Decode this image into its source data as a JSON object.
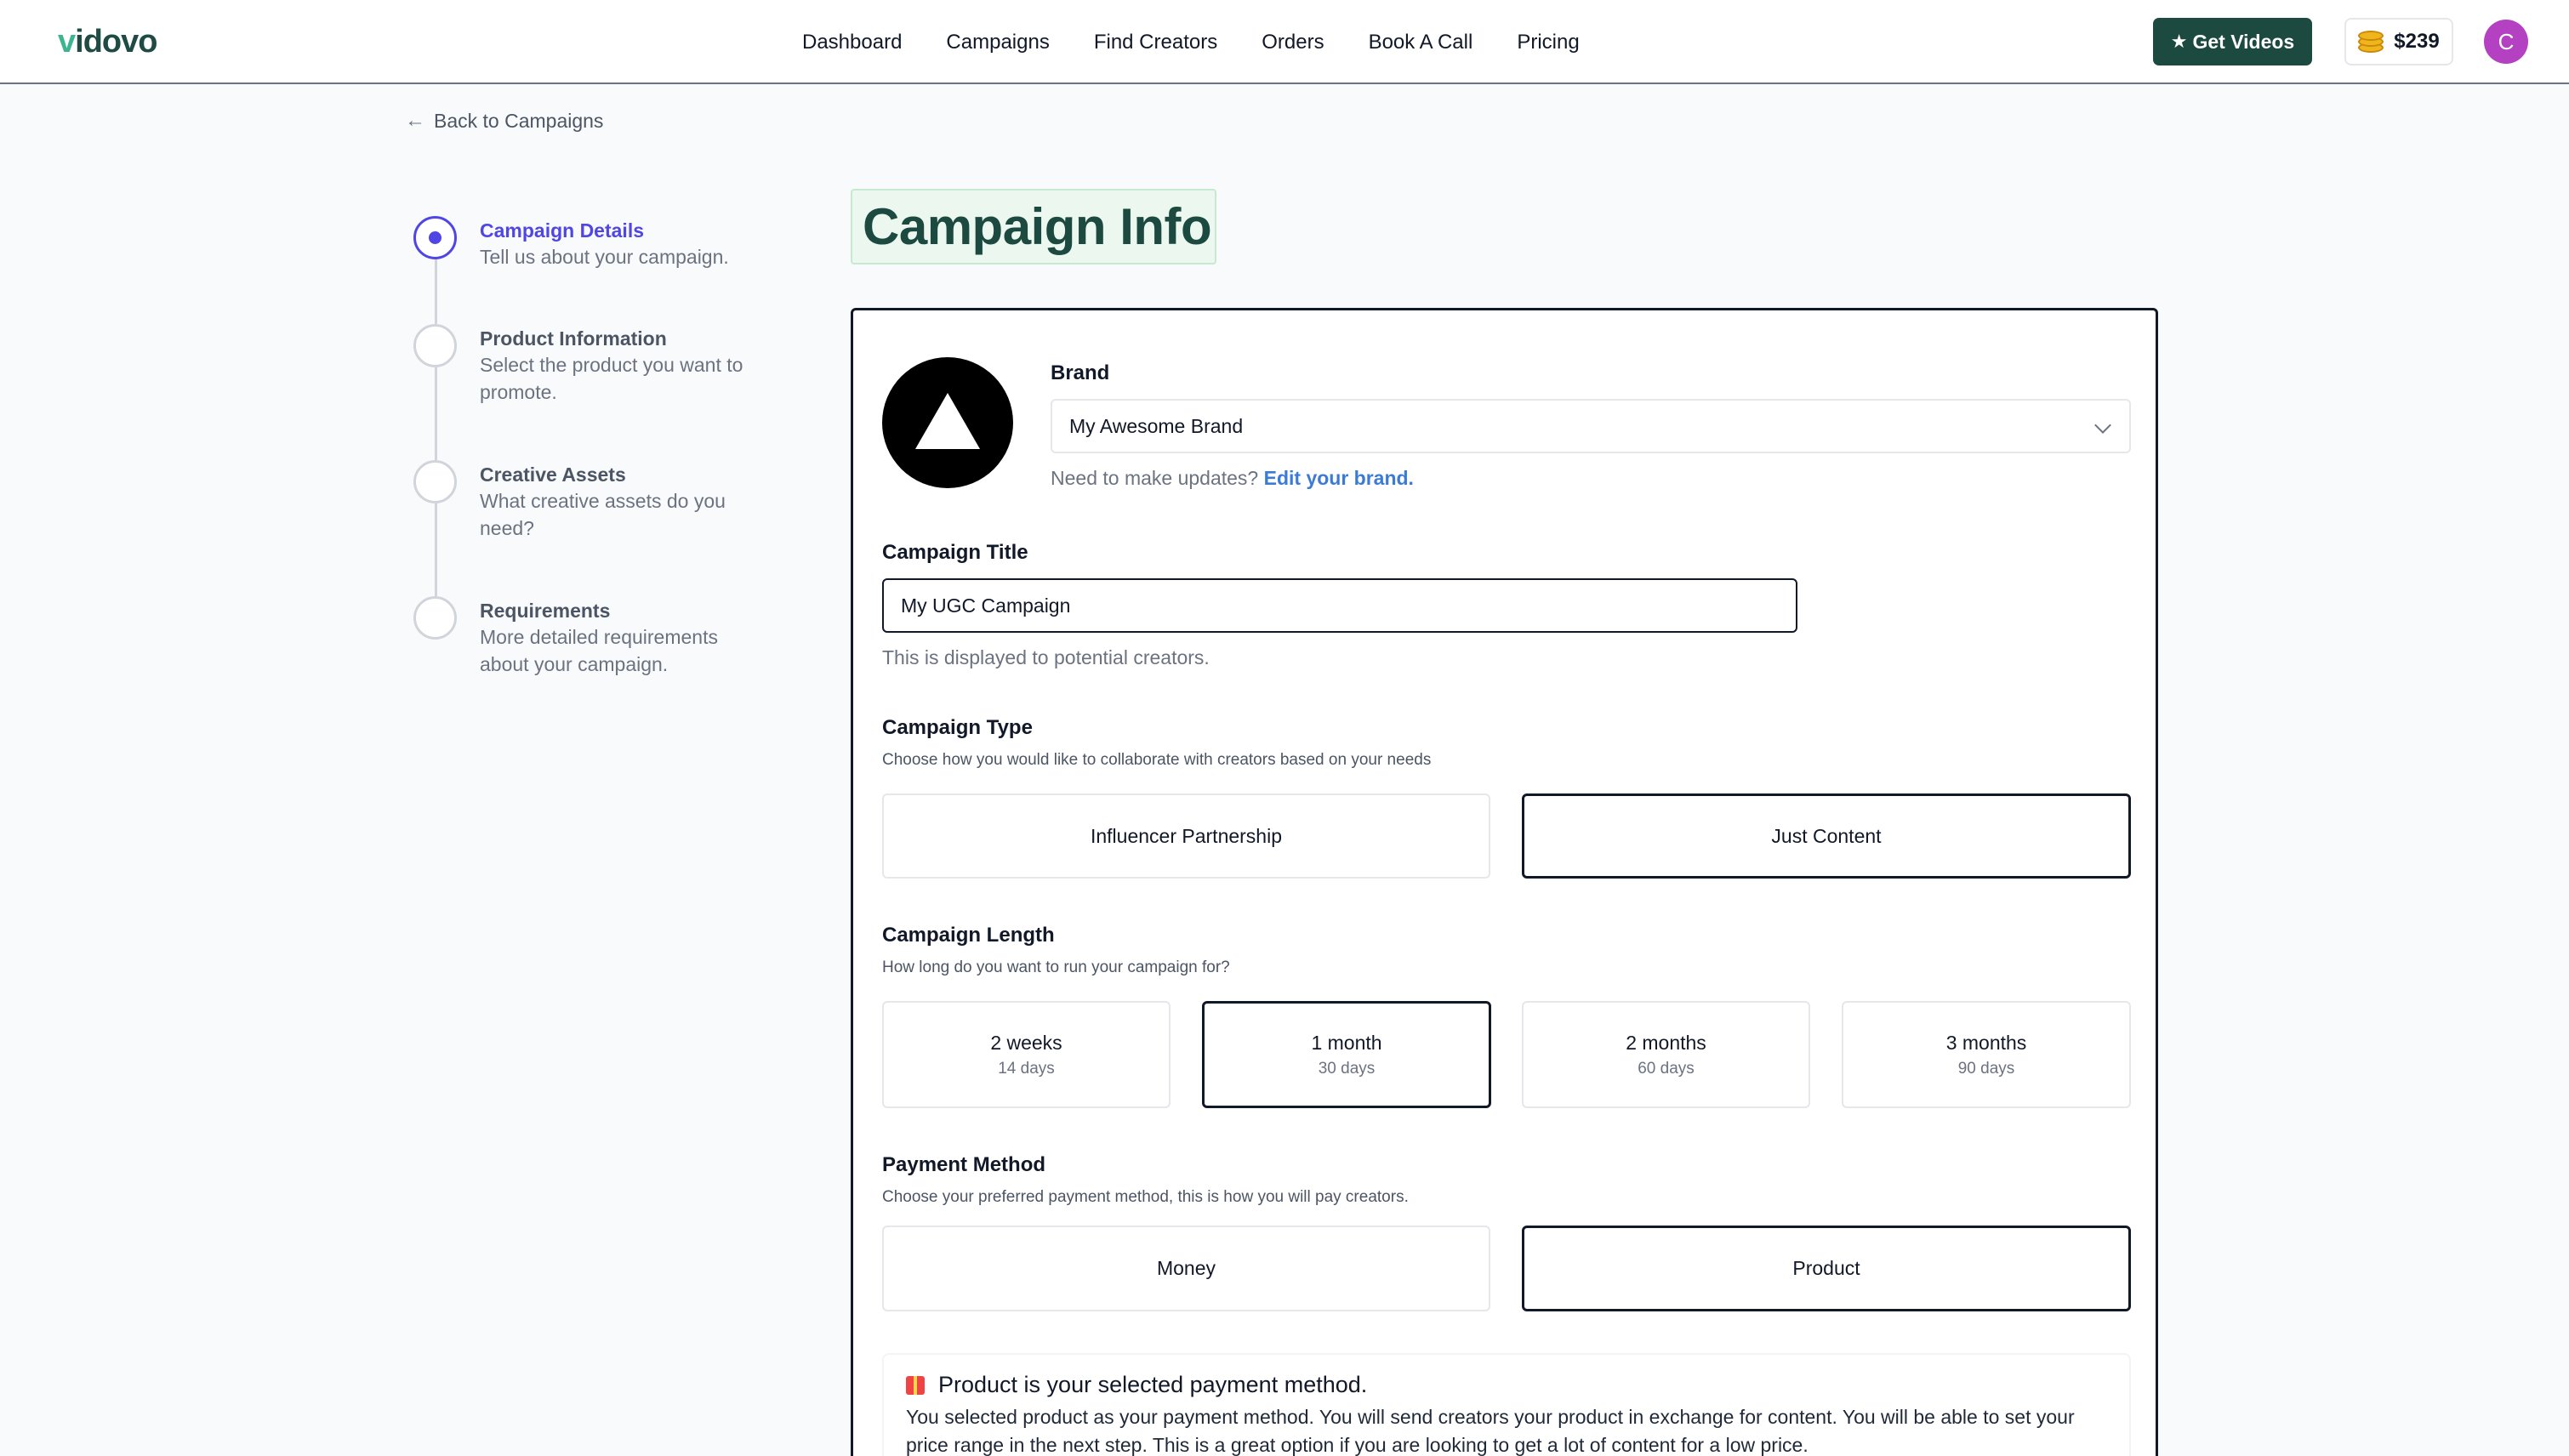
{
  "nav": {
    "logo_prefix": "v",
    "logo_rest": "idovo",
    "links": [
      "Dashboard",
      "Campaigns",
      "Find Creators",
      "Orders",
      "Book A Call",
      "Pricing"
    ],
    "get_videos_label": "Get Videos",
    "credits": "$239",
    "avatar_initial": "C"
  },
  "back_label": "Back to Campaigns",
  "steps": [
    {
      "title": "Campaign Details",
      "desc": "Tell us about your campaign.",
      "active": true
    },
    {
      "title": "Product Information",
      "desc": "Select the product you want to promote.",
      "active": false
    },
    {
      "title": "Creative Assets",
      "desc": "What creative assets do you need?",
      "active": false
    },
    {
      "title": "Requirements",
      "desc": "More detailed requirements about your campaign.",
      "active": false
    }
  ],
  "page_title": "Campaign Info",
  "form": {
    "brand_label": "Brand",
    "brand_value": "My Awesome Brand",
    "brand_help": "Need to make updates?",
    "brand_help_link": "Edit your brand.",
    "title_label": "Campaign Title",
    "title_value": "My UGC Campaign",
    "title_help": "This is displayed to potential creators.",
    "type_label": "Campaign Type",
    "type_sub": "Choose how you would like to collaborate with creators based on your needs",
    "type_options": [
      {
        "label": "Influencer Partnership",
        "selected": false
      },
      {
        "label": "Just Content",
        "selected": true
      }
    ],
    "length_label": "Campaign Length",
    "length_sub": "How long do you want to run your campaign for?",
    "length_options": [
      {
        "label": "2 weeks",
        "sub": "14 days",
        "selected": false
      },
      {
        "label": "1 month",
        "sub": "30 days",
        "selected": true
      },
      {
        "label": "2 months",
        "sub": "60 days",
        "selected": false
      },
      {
        "label": "3 months",
        "sub": "90 days",
        "selected": false
      }
    ],
    "payment_label": "Payment Method",
    "payment_sub": "Choose your preferred payment method, this is how you will pay creators.",
    "payment_options": [
      {
        "label": "Money",
        "selected": false
      },
      {
        "label": "Product",
        "selected": true
      }
    ],
    "notice_title": "Product is your selected payment method.",
    "notice_body": "You selected product as your payment method. You will send creators your product in exchange for content. You will be able to set your price range in the next step. This is a great option if you are looking to get a lot of content for a low price."
  }
}
